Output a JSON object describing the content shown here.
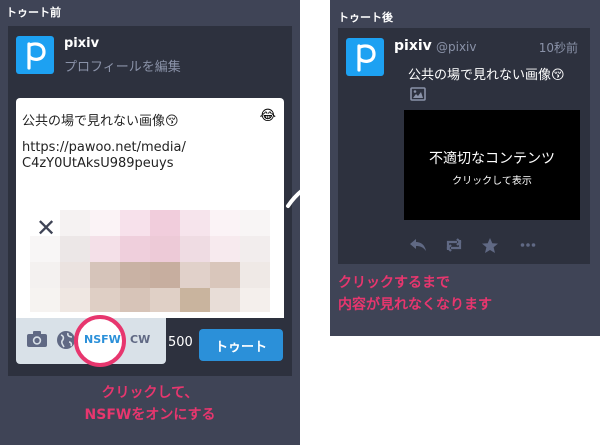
{
  "before": {
    "header": "トゥート前",
    "account_name": "pixiv",
    "edit_profile": "プロフィールを編集",
    "compose_text": "公共の場で見れない画像😚",
    "url_line1": "https://pawoo.net/media/",
    "url_line2": "C4zY0UtAksU989peuys",
    "emoji_button": "😂",
    "remove_media": "✕",
    "nsfw_label": "NSFW",
    "cw_label": "CW",
    "char_count": "500",
    "toot_button": "トゥート",
    "caption_line1": "クリックして、",
    "caption_line2": "NSFWをオンにする",
    "thumbnail_colors": [
      [
        "#ffffff",
        "#f5f2f2",
        "#fbf3f6",
        "#f7e1eb",
        "#f1cddc",
        "#f6e4ec",
        "#fbf3f6",
        "#f8f5f5"
      ],
      [
        "#f8f6f6",
        "#ece7e7",
        "#f4e0e8",
        "#efcfdc",
        "#edcad7",
        "#efdce3",
        "#f7eaee",
        "#f2eded"
      ],
      [
        "#f4f1f0",
        "#ebe3e0",
        "#d6c4ba",
        "#c9b2a4",
        "#c7ae9f",
        "#e1d1ca",
        "#d9c6bb",
        "#efe9e6"
      ],
      [
        "#f6f3f1",
        "#efe7e2",
        "#dfcfc5",
        "#d7c4b8",
        "#e0d0c6",
        "#c9b49e",
        "#e8ddd7",
        "#f4efec"
      ]
    ]
  },
  "after": {
    "header": "トゥート後",
    "account_name": "pixiv",
    "handle": "@pixiv",
    "timestamp": "10秒前",
    "status_text": "公共の場で見れない画像😚",
    "sensitive_title": "不適切なコンテンツ",
    "sensitive_sub": "クリックして表示",
    "caption_line1": "クリックするまで",
    "caption_line2": "内容が見れなくなります"
  },
  "colors": {
    "panel_bg": "#3f4456",
    "card_bg": "#2d313e",
    "accent_blue": "#2b90d9",
    "highlight_pink": "#e7366e",
    "pixiv_blue": "#1da1f2"
  },
  "icons": [
    "camera-icon",
    "globe-icon",
    "reply-icon",
    "boost-icon",
    "star-icon",
    "more-icon",
    "image-icon",
    "arrow-icon"
  ]
}
